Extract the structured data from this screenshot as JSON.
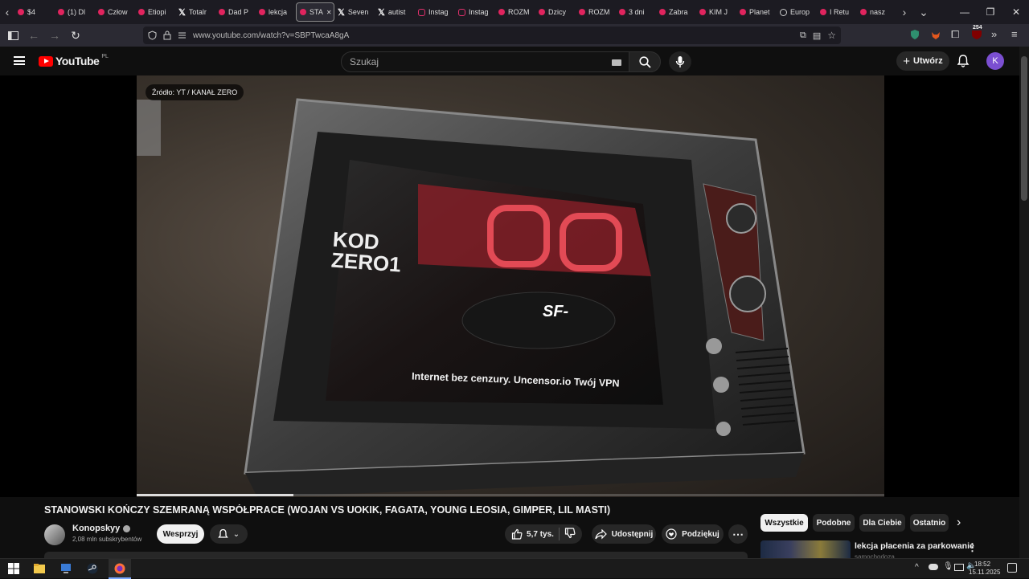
{
  "browser": {
    "tabs": [
      {
        "label": "$4",
        "icon": "youtube-favicon"
      },
      {
        "label": "(1) Dl",
        "icon": "youtube-favicon"
      },
      {
        "label": "Człow",
        "icon": "youtube-favicon"
      },
      {
        "label": "Etiopi",
        "icon": "youtube-favicon"
      },
      {
        "label": "Totalr",
        "icon": "x-favicon"
      },
      {
        "label": "Dad P",
        "icon": "youtube-favicon"
      },
      {
        "label": "lekcja",
        "icon": "youtube-favicon"
      },
      {
        "label": "STA",
        "icon": "youtube-favicon",
        "active": true
      },
      {
        "label": "Seven",
        "icon": "x-favicon"
      },
      {
        "label": "autist",
        "icon": "x-favicon"
      },
      {
        "label": "Instag",
        "icon": "instagram-favicon"
      },
      {
        "label": "Instag",
        "icon": "instagram-favicon"
      },
      {
        "label": "ROZM",
        "icon": "youtube-favicon"
      },
      {
        "label": "Dzicy",
        "icon": "youtube-favicon"
      },
      {
        "label": "ROZM",
        "icon": "youtube-favicon"
      },
      {
        "label": "3 dni",
        "icon": "youtube-favicon"
      },
      {
        "label": "Zabra",
        "icon": "youtube-favicon"
      },
      {
        "label": "KIM J",
        "icon": "youtube-favicon"
      },
      {
        "label": "Planet",
        "icon": "youtube-favicon"
      },
      {
        "label": "Europ",
        "icon": "globe-favicon"
      },
      {
        "label": "I Retu",
        "icon": "youtube-favicon"
      },
      {
        "label": "nasz",
        "icon": "youtube-favicon"
      }
    ],
    "url": "www.youtube.com/watch?v=SBPTwcaA8gA",
    "extension_badge": "254"
  },
  "youtube": {
    "logo_text": "YouTube",
    "country_code": "PL",
    "search_placeholder": "Szukaj",
    "create_label": "Utwórz",
    "avatar_letter": "K"
  },
  "video": {
    "source_overlay": "Źródło: YT / KANAŁ ZERO",
    "progress_fraction": 0.21,
    "title": "STANOWSKI KOŃCZY SZEMRANĄ WSPÓŁPRACE (WOJAN VS UOKIK, FAGATA, YOUNG LEOSIA, GIMPER, LIL MASTI)",
    "channel_name": "Konopskyy",
    "subscribers": "2,08 mln subskrybentów",
    "support_label": "Wesprzyj",
    "likes": "5,7 tys.",
    "share_label": "Udostępnij",
    "thanks_label": "Podziękuj",
    "tv_screen_text": "Internet bez cenzury. Uncensor.io Twój VPN",
    "tv_logo_text": "SF-",
    "tv_side_text": "KOD ZERO1"
  },
  "sidebar": {
    "chips": [
      "Wszystkie",
      "Podobne",
      "Dla Ciebie",
      "Ostatnio"
    ],
    "recommendation": {
      "title": "lekcja płacenia za parkowanie",
      "channel": "samochodoza"
    }
  },
  "taskbar": {
    "time": "18:52",
    "date": "15.11.2025"
  },
  "colors": {
    "accent_red": "#ff0000",
    "avatar_bg": "#7b4fd1"
  }
}
